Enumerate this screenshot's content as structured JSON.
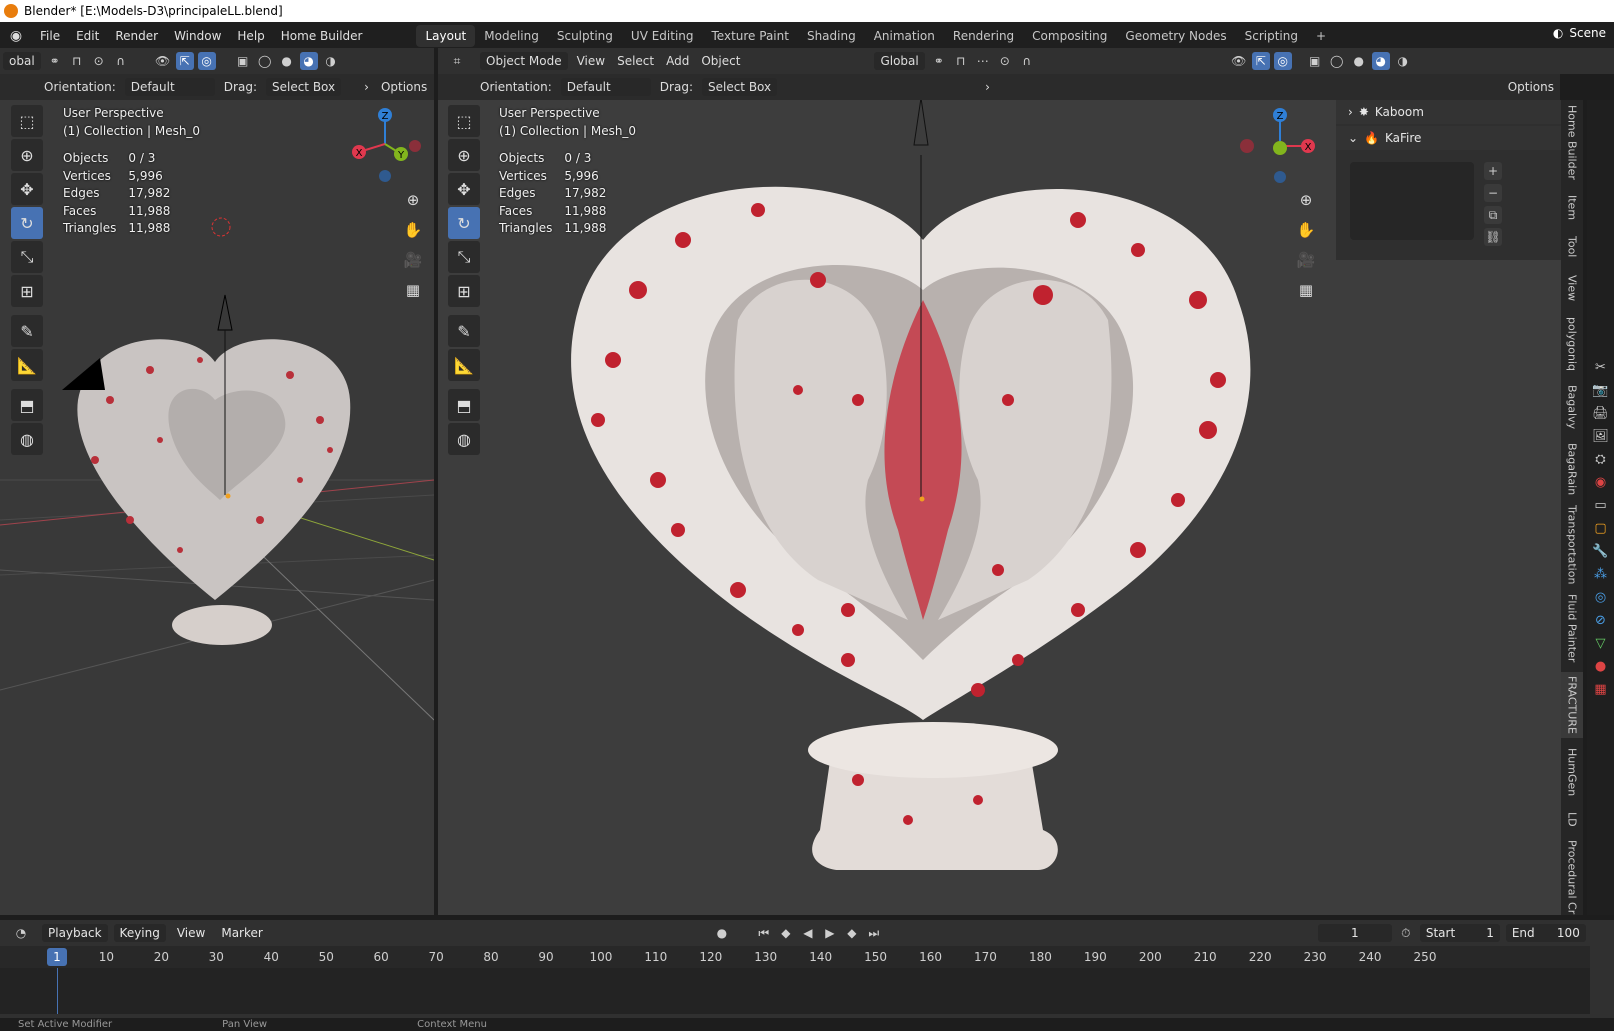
{
  "window_title": "Blender* [E:\\Models-D3\\principaleLL.blend]",
  "menus": [
    "File",
    "Edit",
    "Render",
    "Window",
    "Help",
    "Home Builder"
  ],
  "workspaces": [
    "Layout",
    "Modeling",
    "Sculpting",
    "UV Editing",
    "Texture Paint",
    "Shading",
    "Animation",
    "Rendering",
    "Compositing",
    "Geometry Nodes",
    "Scripting"
  ],
  "active_workspace": "Layout",
  "scene": "Scene",
  "left_vp": {
    "transform": "obal",
    "orientation_label": "Orientation:",
    "orientation": "Default",
    "drag_label": "Drag:",
    "drag": "Select Box",
    "options": "Options",
    "perspective": "User Perspective",
    "collection": "(1) Collection | Mesh_0"
  },
  "right_vp": {
    "mode": "Object Mode",
    "menus": [
      "View",
      "Select",
      "Add",
      "Object"
    ],
    "transform": "Global",
    "orientation_label": "Orientation:",
    "orientation": "Default",
    "drag_label": "Drag:",
    "drag": "Select Box",
    "options": "Options",
    "perspective": "User Perspective",
    "collection": "(1) Collection | Mesh_0"
  },
  "stats": [
    {
      "label": "Objects",
      "value": "0 / 3"
    },
    {
      "label": "Vertices",
      "value": "5,996"
    },
    {
      "label": "Edges",
      "value": "17,982"
    },
    {
      "label": "Faces",
      "value": "11,988"
    },
    {
      "label": "Triangles",
      "value": "11,988"
    }
  ],
  "gizmo_axes": {
    "x": "X",
    "y": "Y",
    "z": "Z"
  },
  "side_panel": {
    "kaboom": "Kaboom",
    "kafire": "KaFire"
  },
  "side_tabs": [
    "Home Builder",
    "Item",
    "Tool",
    "View",
    "polygoniq",
    "Bagalvy",
    "BagaRain",
    "Transportation",
    "Fluid Painter",
    "FRACTURE",
    "HumGen",
    "LD",
    "Procedural Cr"
  ],
  "timeline": {
    "menus": [
      "Playback",
      "Keying",
      "View",
      "Marker"
    ],
    "current_frame": "1",
    "start_label": "Start",
    "start": "1",
    "end_label": "End",
    "end": "100",
    "ticks": [
      "1",
      "10",
      "20",
      "30",
      "40",
      "50",
      "60",
      "70",
      "80",
      "90",
      "100",
      "110",
      "120",
      "130",
      "140",
      "150",
      "160",
      "170",
      "180",
      "190",
      "200",
      "210",
      "220",
      "230",
      "240",
      "250"
    ]
  },
  "status": {
    "a": "Set Active Modifier",
    "b": "Pan View",
    "c": "Context Menu"
  },
  "colors": {
    "accent": "#4772b3",
    "x_axis": "#e0384e",
    "y_axis": "#82b51d",
    "z_axis": "#2f7fd6"
  }
}
